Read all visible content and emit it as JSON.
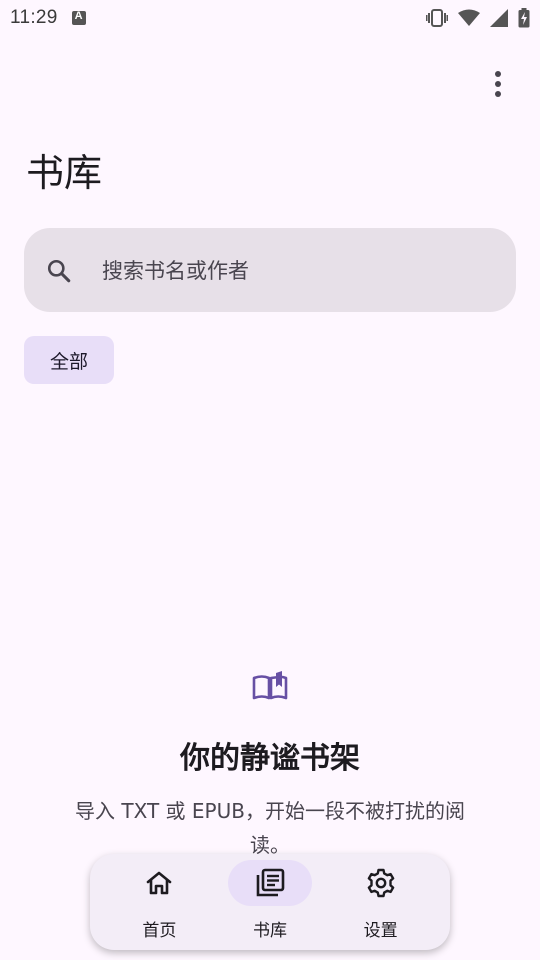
{
  "status_bar": {
    "time": "11:29",
    "icons": [
      "notification-a-icon",
      "vibrate-icon",
      "wifi-icon",
      "signal-icon",
      "battery-charging-icon"
    ]
  },
  "header": {
    "title": "书库",
    "more_icon": "more-vertical-icon"
  },
  "search": {
    "placeholder": "搜索书名或作者",
    "value": "",
    "icon": "search-icon"
  },
  "filters": [
    {
      "label": "全部",
      "selected": true
    }
  ],
  "empty_state": {
    "icon": "open-book-icon",
    "title": "你的静谧书架",
    "description": "导入 TXT 或 EPUB，开始一段不被打扰的阅读。"
  },
  "bottom_nav": {
    "items": [
      {
        "label": "首页",
        "icon": "home-icon",
        "active": false
      },
      {
        "label": "书库",
        "icon": "library-icon",
        "active": true
      },
      {
        "label": "设置",
        "icon": "settings-gear-icon",
        "active": false
      }
    ]
  },
  "colors": {
    "background": "#FEF7FF",
    "search_bg": "#E7E0E8",
    "chip_bg": "#E8DEF8",
    "accent": "#6750A4",
    "nav_bg": "#F3EDF7"
  }
}
